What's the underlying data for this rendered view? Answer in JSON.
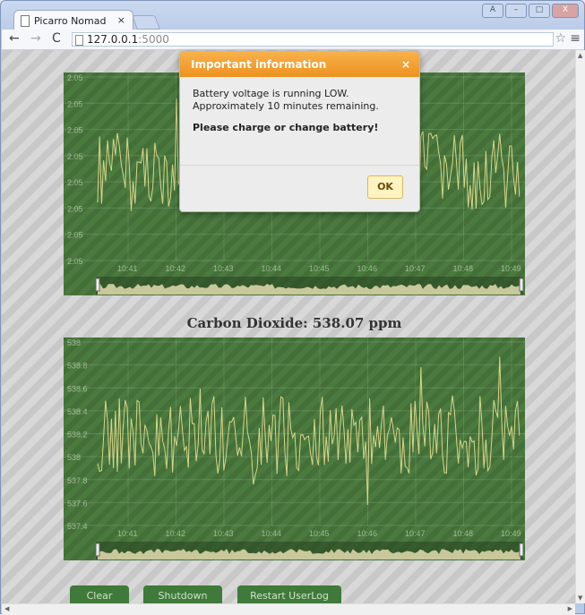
{
  "browser": {
    "tab_title": "Picarro Nomad",
    "tab_close": "×",
    "url_host": "127.0.0.1",
    "url_port": ":5000",
    "win_buttons": [
      "A",
      "–",
      "□",
      "X"
    ]
  },
  "chart1": {
    "y_ticks": [
      "2.05",
      "2.05",
      "2.05",
      "2.05",
      "2.05",
      "2.05",
      "2.05",
      "2.05"
    ],
    "x_ticks": [
      "10:41",
      "10:42",
      "10:43",
      "10:44",
      "10:45",
      "10:46",
      "10:47",
      "10:48",
      "10:49"
    ],
    "line_color": "#d8d68a"
  },
  "chart2_title": "Carbon Dioxide: 538.07 ppm",
  "chart2": {
    "y_ticks": [
      "538",
      "538.8",
      "538.6",
      "538.4",
      "538.2",
      "538",
      "537.8",
      "537.6",
      "537.4"
    ],
    "x_ticks": [
      "10:41",
      "10:42",
      "10:43",
      "10:44",
      "10:45",
      "10:46",
      "10:47",
      "10:48",
      "10:49"
    ],
    "line_color": "#d8d68a"
  },
  "buttons": [
    "Clear",
    "Shutdown",
    "Restart UserLog"
  ],
  "modal": {
    "title": "Important information",
    "close": "×",
    "line1": "Battery voltage is running LOW.",
    "line2": "Approximately 10 minutes remaining.",
    "line3": "Please charge or change battery!",
    "ok": "OK"
  },
  "colors": {
    "chart_bg": "#4b7a3f",
    "modal_header": "#f0a030",
    "button_bg": "#3f7a3a"
  }
}
